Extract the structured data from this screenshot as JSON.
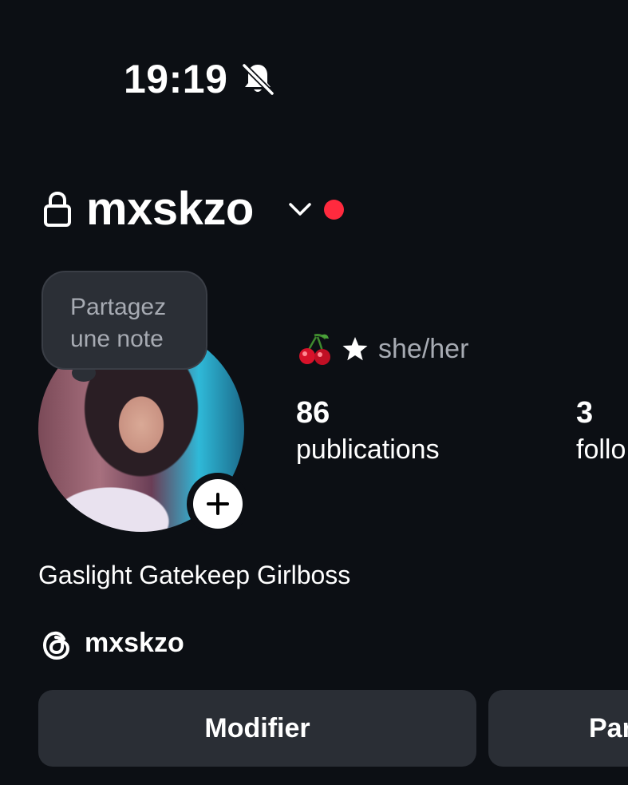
{
  "status_bar": {
    "time": "19:19",
    "silent_icon": "bell-slash-icon"
  },
  "header": {
    "lock_icon": "lock-icon",
    "username": "mxskzo",
    "switch_icon": "chevron-down-icon",
    "live_indicator_color": "#ff2a3e"
  },
  "note": {
    "text": "Partagez une note"
  },
  "profile": {
    "pronouns_emoji": "cherry-icon",
    "pronouns_symbol": "star-icon",
    "pronouns": "she/her",
    "bio": "Gaslight Gatekeep Girlboss",
    "threads_handle": "mxskzo"
  },
  "stats": [
    {
      "value": "86",
      "label": "publications"
    },
    {
      "value": "3",
      "label": "follo"
    }
  ],
  "buttons": {
    "edit": "Modifier",
    "share": "Par"
  },
  "colors": {
    "background": "#0c0f14",
    "button_bg": "#2a2e35",
    "muted_text": "#a7abb3"
  }
}
